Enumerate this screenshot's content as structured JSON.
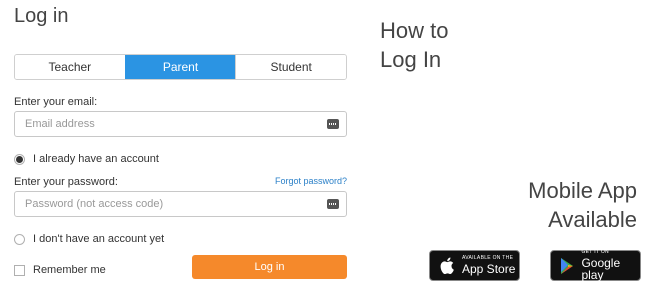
{
  "login": {
    "title": "Log in",
    "roles": [
      "Teacher",
      "Parent",
      "Student"
    ],
    "active_role": "Parent",
    "email_label": "Enter your email:",
    "email_placeholder": "Email address",
    "have_account_label": "I already have an account",
    "password_label": "Enter your password:",
    "forgot_link": "Forgot password?",
    "password_placeholder": "Password (not access code)",
    "no_account_label": "I don't have an account yet",
    "remember_label": "Remember me",
    "login_button": "Log in"
  },
  "side": {
    "howto_line1": "How to",
    "howto_line2": "Log In",
    "mobile_line1": "Mobile App",
    "mobile_line2": "Available",
    "app_store_small": "AVAILABLE ON THE",
    "app_store_big": "App Store",
    "google_small": "GET IT ON",
    "google_big": "Google play"
  },
  "colors": {
    "accent_blue": "#2b94e3",
    "login_orange": "#f5892b",
    "link_blue": "#2b80c8"
  }
}
